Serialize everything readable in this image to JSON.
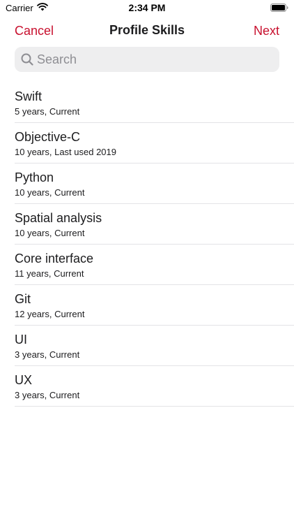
{
  "status_bar": {
    "carrier": "Carrier",
    "time": "2:34 PM"
  },
  "nav": {
    "cancel_label": "Cancel",
    "title": "Profile Skills",
    "next_label": "Next",
    "accent_color": "#c8102e"
  },
  "search": {
    "placeholder": "Search",
    "value": ""
  },
  "skills": [
    {
      "name": "Swift",
      "detail": "5 years, Current"
    },
    {
      "name": "Objective-C",
      "detail": "10 years, Last used 2019"
    },
    {
      "name": "Python",
      "detail": "10 years, Current"
    },
    {
      "name": "Spatial analysis",
      "detail": "10 years, Current"
    },
    {
      "name": "Core interface",
      "detail": "11 years, Current"
    },
    {
      "name": "Git",
      "detail": "12 years, Current"
    },
    {
      "name": "UI",
      "detail": "3 years, Current"
    },
    {
      "name": "UX",
      "detail": "3 years, Current"
    }
  ],
  "icons": {
    "wifi": "wifi-icon",
    "battery": "battery-icon",
    "search": "search-icon"
  }
}
